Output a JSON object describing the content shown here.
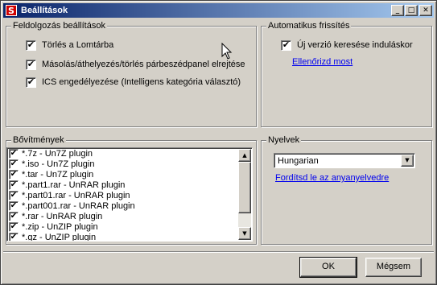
{
  "window": {
    "title": "Beállítások",
    "app_icon_glyph": "S",
    "app_icon_color": "#d00000",
    "title_gradient": [
      "#0a246a",
      "#a6caf0"
    ],
    "controls": {
      "minimize": "_",
      "maximize": "□",
      "close": "✕"
    }
  },
  "processing": {
    "title": "Feldolgozás beállítások",
    "options": [
      {
        "label": "Törlés a Lomtárba",
        "checked": true
      },
      {
        "label": "Másolás/áthelyezés/törlés párbeszédpanel elrejtése",
        "checked": true
      },
      {
        "label": "ICS engedélyezése (Intelligens kategória választó)",
        "checked": true
      }
    ]
  },
  "auto_update": {
    "title": "Automatikus frissítés",
    "option": {
      "label": "Új verzió keresése induláskor",
      "checked": true
    },
    "check_now_link": "Ellenőrizd most"
  },
  "extensions": {
    "title": "Bővítmények",
    "items": [
      {
        "label": "*.7z - Un7Z plugin",
        "checked": true
      },
      {
        "label": "*.iso - Un7Z plugin",
        "checked": true
      },
      {
        "label": "*.tar - Un7Z plugin",
        "checked": true
      },
      {
        "label": "*.part1.rar - UnRAR plugin",
        "checked": true
      },
      {
        "label": "*.part01.rar - UnRAR plugin",
        "checked": true
      },
      {
        "label": "*.part001.rar - UnRAR plugin",
        "checked": true
      },
      {
        "label": "*.rar - UnRAR plugin",
        "checked": true
      },
      {
        "label": "*.zip - UnZIP plugin",
        "checked": true
      },
      {
        "label": "*.gz - UnZIP plugin",
        "checked": true
      }
    ],
    "scroll_up_icon": "▲",
    "scroll_down_icon": "▼"
  },
  "languages": {
    "title": "Nyelvek",
    "selected": "Hungarian",
    "dropdown_icon": "▼",
    "translate_link": "Fordítsd le az anyanyelvedre"
  },
  "buttons": {
    "ok": "OK",
    "cancel": "Mégsem"
  },
  "check_mark": "✔",
  "link_color": "#0000ee"
}
